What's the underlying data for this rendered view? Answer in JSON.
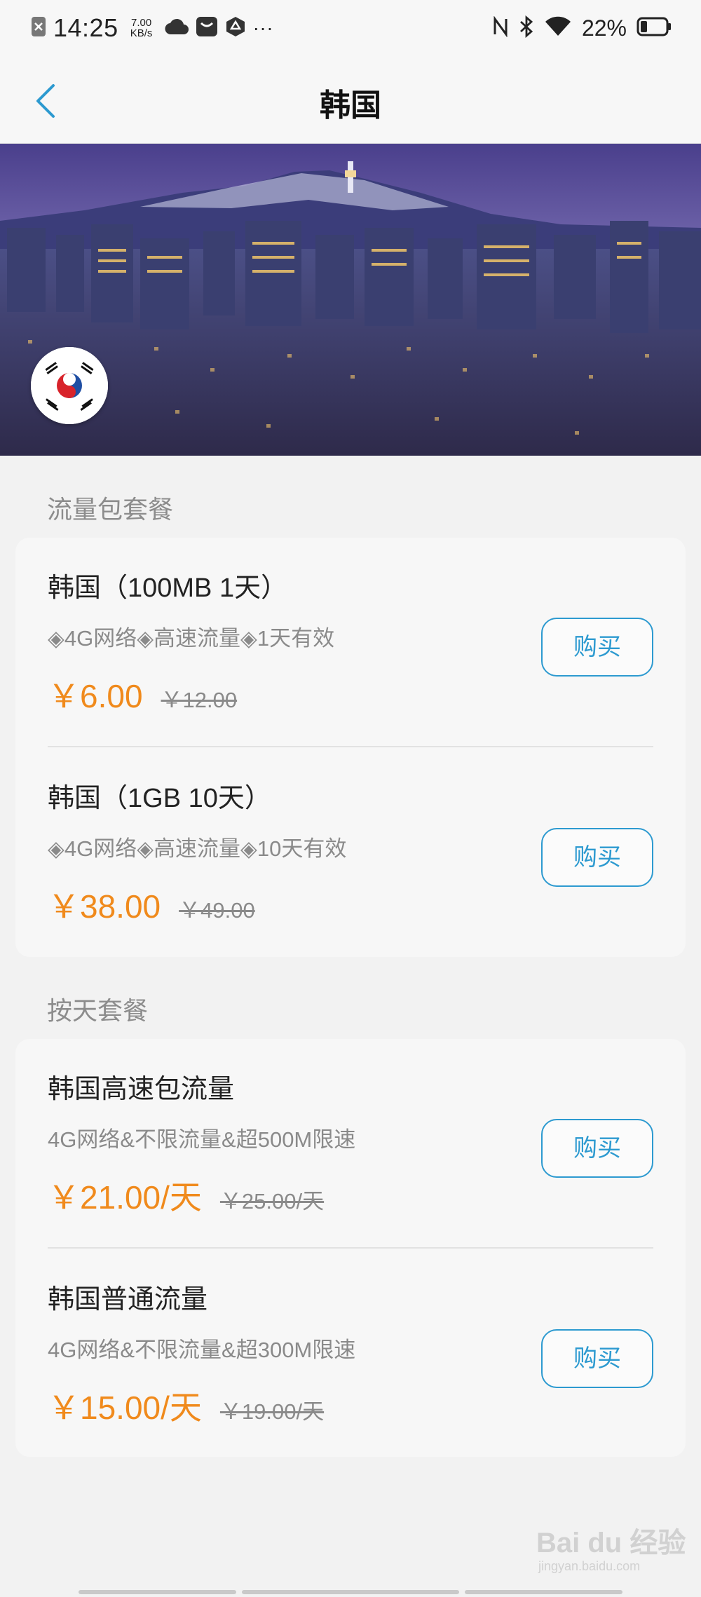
{
  "status_bar": {
    "time": "14:25",
    "net_speed_value": "7.00",
    "net_speed_unit": "KB/s",
    "more": "···",
    "battery": "22%"
  },
  "header": {
    "title": "韩国"
  },
  "sections": [
    {
      "title": "流量包套餐",
      "items": [
        {
          "name": "韩国（100MB 1天）",
          "desc": "◈4G网络◈高速流量◈1天有效",
          "price": "￥6.00",
          "old_price": "￥12.00",
          "button": "购买"
        },
        {
          "name": "韩国（1GB 10天）",
          "desc": "◈4G网络◈高速流量◈10天有效",
          "price": "￥38.00",
          "old_price": "￥49.00",
          "button": "购买"
        }
      ]
    },
    {
      "title": "按天套餐",
      "items": [
        {
          "name": "韩国高速包流量",
          "desc": "4G网络&不限流量&超500M限速",
          "price": "￥21.00/天",
          "old_price": "￥25.00/天",
          "button": "购买"
        },
        {
          "name": "韩国普通流量",
          "desc": "4G网络&不限流量&超300M限速",
          "price": "￥15.00/天",
          "old_price": "￥19.00/天",
          "button": "购买"
        }
      ]
    }
  ],
  "watermark": {
    "text": "Bai du 经验",
    "sub": "jingyan.baidu.com"
  },
  "colors": {
    "price": "#f08a1c",
    "accent": "#2d9ad0",
    "section_title": "#8c8c8c"
  }
}
